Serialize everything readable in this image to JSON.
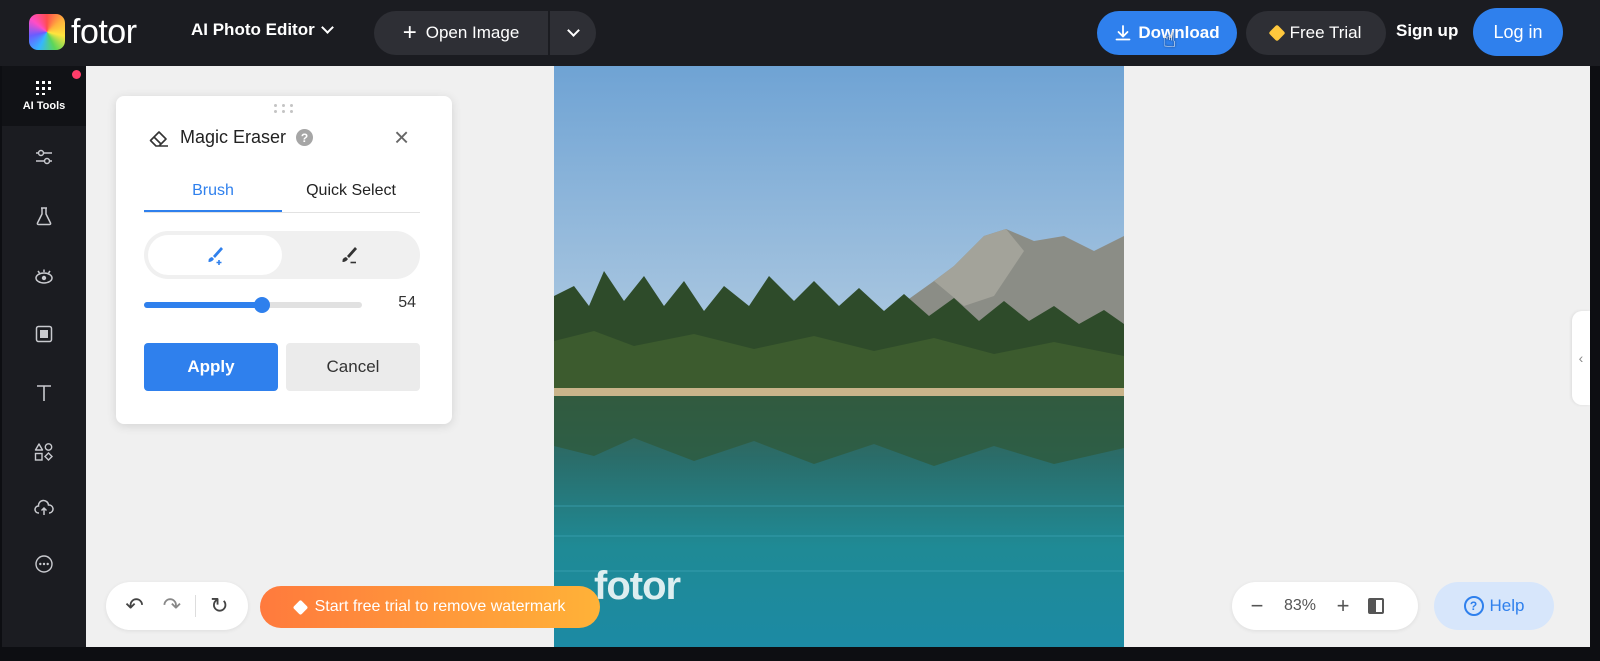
{
  "header": {
    "logo_text": "fotor",
    "app_menu_label": "AI Photo Editor",
    "open_image_label": "Open Image",
    "download_label": "Download",
    "free_trial_label": "Free Trial",
    "signup_label": "Sign up",
    "login_label": "Log in"
  },
  "sidebar": {
    "active_label": "AI Tools",
    "items": [
      {
        "icon": "ai-tools-icon",
        "label": "AI Tools"
      },
      {
        "icon": "adjust-sliders-icon"
      },
      {
        "icon": "flask-icon"
      },
      {
        "icon": "eye-icon"
      },
      {
        "icon": "frame-icon"
      },
      {
        "icon": "text-icon"
      },
      {
        "icon": "elements-icon"
      },
      {
        "icon": "upload-cloud-icon"
      },
      {
        "icon": "more-icon"
      }
    ]
  },
  "panel": {
    "title": "Magic Eraser",
    "help_glyph": "?",
    "tabs": [
      {
        "label": "Brush",
        "active": true
      },
      {
        "label": "Quick Select",
        "active": false
      }
    ],
    "brush_size": 54,
    "brush_size_max": 100,
    "apply_label": "Apply",
    "cancel_label": "Cancel"
  },
  "canvas": {
    "watermark_text": "fotor"
  },
  "bottom": {
    "trial_banner": "Start free trial to remove watermark",
    "zoom_value": "83%",
    "help_label": "Help"
  },
  "colors": {
    "accent": "#2f80ed",
    "topbar": "#1b1c21",
    "trial_gradient_start": "#ff7a3d",
    "trial_gradient_end": "#ffb238"
  }
}
